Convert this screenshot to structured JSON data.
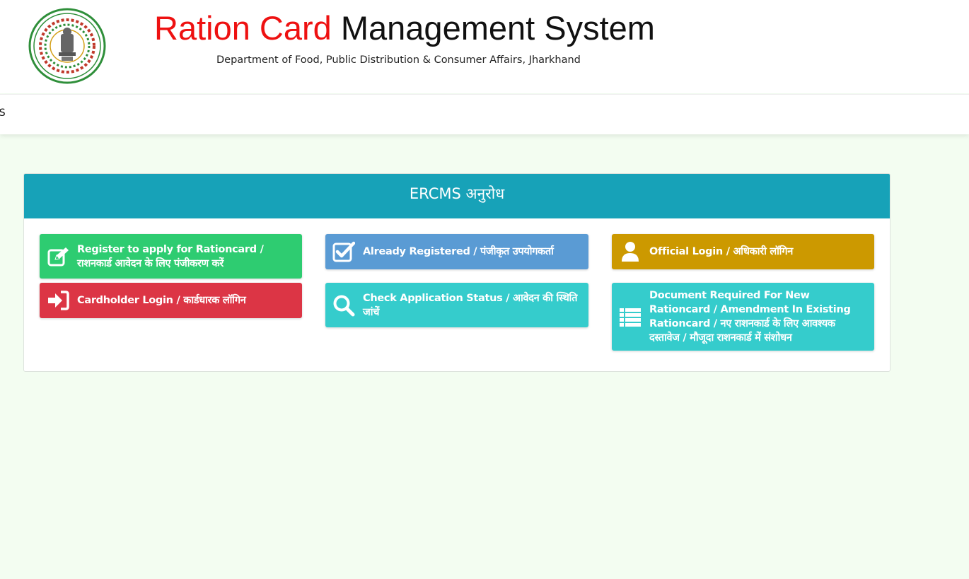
{
  "header": {
    "title_part1": "Ration Card",
    "title_part2": "Management System",
    "subtitle": "Department of Food, Public Distribution & Consumer Affairs, Jharkhand",
    "logo_icon": "government-of-jharkhand-emblem"
  },
  "navbar": {
    "item": "DS"
  },
  "panel": {
    "heading": "ERCMS अनुरोध",
    "buttons": {
      "register": {
        "label": "Register to apply for Rationcard / राशनकार्ड आवेदन के लिए पंजीकरण करें",
        "icon": "edit-icon"
      },
      "cardholder_login": {
        "label": "Cardholder Login / कार्डधारक लॉगिन",
        "icon": "sign-in-icon"
      },
      "already_registered": {
        "label": "Already Registered / पंजीकृत उपयोगकर्ता",
        "icon": "check-square-icon"
      },
      "check_status": {
        "label": "Check Application Status / आवेदन की स्थिति जांचें",
        "icon": "search-icon"
      },
      "official_login": {
        "label": "Official Login / अधिकारी लॉगिन",
        "icon": "user-icon"
      },
      "documents": {
        "label": "Document Required For New Rationcard / Amendment In Existing Rationcard / नए राशनकार्ड के लिए आवश्यक दस्तावेज / मौजूदा राशनकार्ड में संशोधन",
        "icon": "list-icon"
      }
    }
  },
  "colors": {
    "heading": "#17a2b8",
    "green": "#2ecc71",
    "red": "#dc3545",
    "blue": "#5a9bd4",
    "teal": "#35cccc",
    "gold": "#cc9900",
    "title_red": "#ee1111",
    "page_bg": "#f3fdf1"
  }
}
